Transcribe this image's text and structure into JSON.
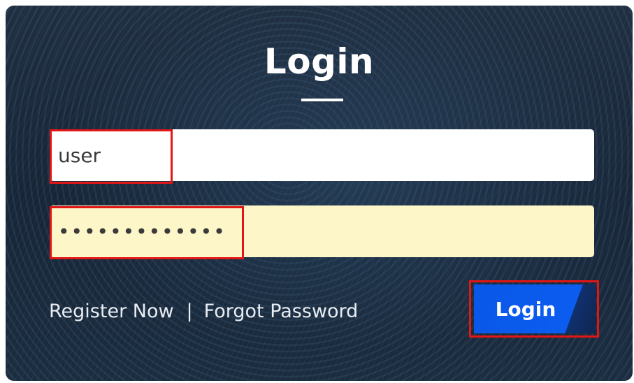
{
  "form": {
    "title": "Login",
    "username_value": "user",
    "password_value": "•••••••••••••",
    "register_label": "Register Now",
    "separator": "|",
    "forgot_label": "Forgot Password",
    "submit_label": "Login"
  },
  "colors": {
    "background": "#1b2b3d",
    "button": "#0b5df0",
    "highlight": "#e11616",
    "password_field_bg": "#fdf6c9"
  }
}
